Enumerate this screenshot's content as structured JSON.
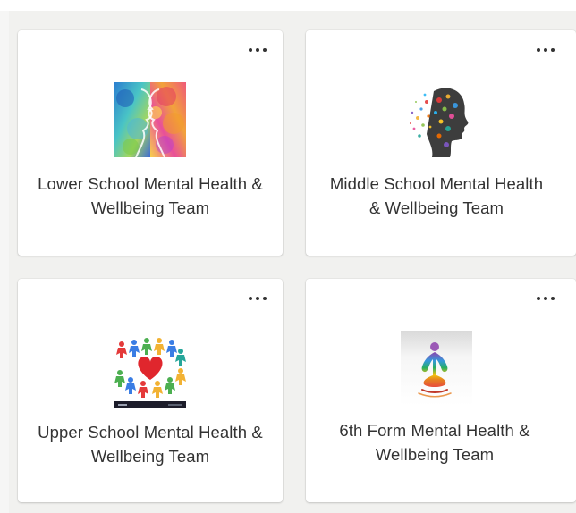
{
  "teams": [
    {
      "name": "Lower School Mental Health & Wellbeing Team",
      "image_icon": "watercolor-faces-icon",
      "more_icon": "more-options-icon"
    },
    {
      "name": "Middle School Mental Health & Wellbeing Team",
      "image_icon": "colorful-head-profile-icon",
      "more_icon": "more-options-icon"
    },
    {
      "name": "Upper School Mental Health & Wellbeing Team",
      "image_icon": "people-circle-heart-icon",
      "more_icon": "more-options-icon"
    },
    {
      "name": "6th Form Mental Health & Wellbeing Team",
      "image_icon": "meditation-figure-icon",
      "more_icon": "more-options-icon"
    }
  ],
  "colors": {
    "background": "#f1f1ef",
    "card": "#ffffff",
    "text": "#333333",
    "heart": "#e0262d"
  }
}
